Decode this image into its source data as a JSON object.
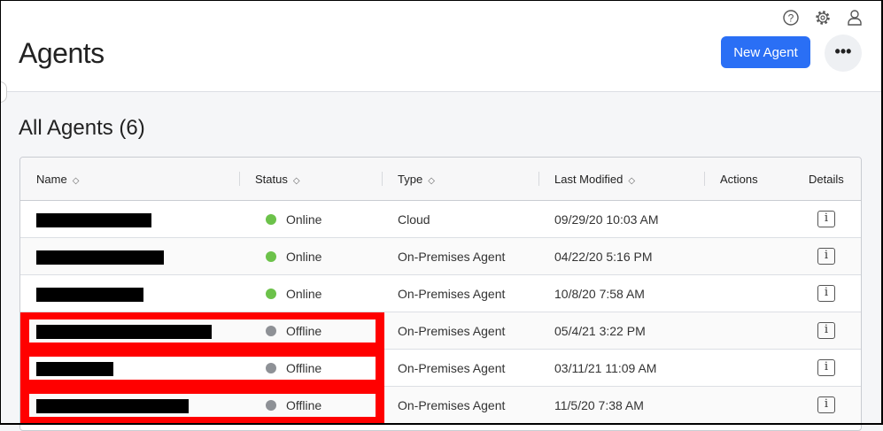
{
  "header": {
    "title": "Agents",
    "new_agent_label": "New Agent",
    "more_label": "•••",
    "accent": "#2a6ff5"
  },
  "section_title": "All Agents (6)",
  "columns": [
    "Name",
    "Status",
    "Type",
    "Last Modified",
    "Actions",
    "Details"
  ],
  "rows": [
    {
      "status": "Online",
      "type": "Cloud",
      "modified": "09/29/20 10:03 AM",
      "highlighted": false
    },
    {
      "status": "Online",
      "type": "On-Premises Agent",
      "modified": "04/22/20 5:16 PM",
      "highlighted": false
    },
    {
      "status": "Online",
      "type": "On-Premises Agent",
      "modified": "10/8/20 7:58 AM",
      "highlighted": false
    },
    {
      "status": "Offline",
      "type": "On-Premises Agent",
      "modified": "05/4/21 3:22 PM",
      "highlighted": true
    },
    {
      "status": "Offline",
      "type": "On-Premises Agent",
      "modified": "03/11/21 11:09 AM",
      "highlighted": true
    },
    {
      "status": "Offline",
      "type": "On-Premises Agent",
      "modified": "11/5/20 7:38 AM",
      "highlighted": true
    }
  ],
  "colors": {
    "online": "#6cc24a",
    "offline": "#8e9196",
    "highlight": "#ff0000"
  }
}
